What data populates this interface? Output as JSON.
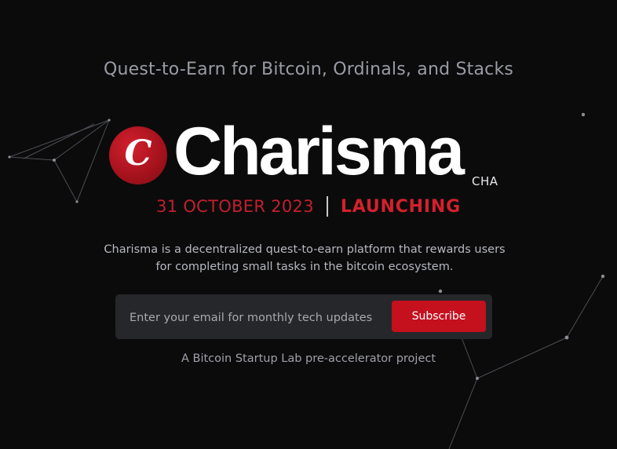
{
  "hero": {
    "tagline": "Quest-to-Earn for Bitcoin, Ordinals, and Stacks",
    "logo_glyph": "C",
    "brand_name": "Charisma",
    "ticker": "CHA",
    "date": "31 OCTOBER 2023",
    "launch_label": "LAUNCHING",
    "description": "Charisma is a decentralized quest-to-earn platform that rewards users for completing small tasks in the bitcoin ecosystem."
  },
  "subscribe": {
    "email_placeholder": "Enter your email for monthly tech updates",
    "email_value": "",
    "button_label": "Subscribe"
  },
  "footer": {
    "note": "A Bitcoin Startup Lab pre-accelerator project"
  },
  "colors": {
    "background": "#0b0b0c",
    "accent_red": "#c5101e",
    "text_light": "#ffffff",
    "text_muted": "#9a9ca4",
    "form_bg": "#26272b"
  },
  "icons": {
    "logo": "charisma-logo-icon"
  }
}
